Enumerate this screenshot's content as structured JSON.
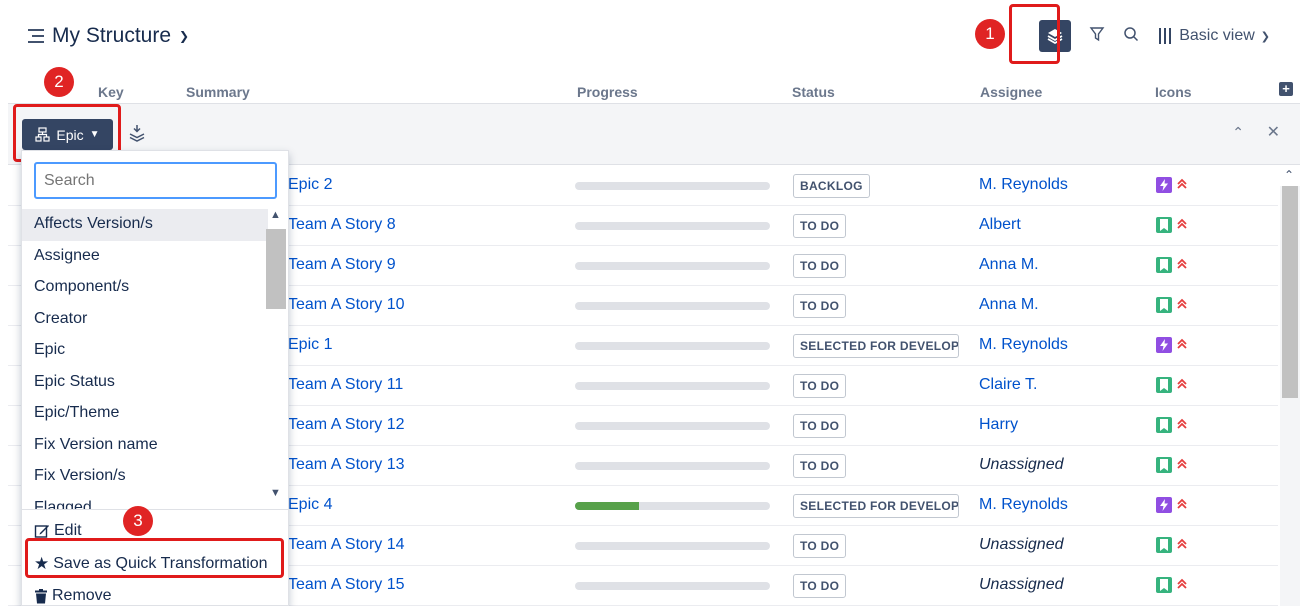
{
  "header": {
    "title": "My Structure",
    "view_label": "Basic view"
  },
  "columns": {
    "key": "Key",
    "summary": "Summary",
    "progress": "Progress",
    "status": "Status",
    "assignee": "Assignee",
    "icons": "Icons"
  },
  "transform": {
    "epic_label": "Epic"
  },
  "dropdown": {
    "search_placeholder": "Search",
    "items": [
      "Affects Version/s",
      "Assignee",
      "Component/s",
      "Creator",
      "Epic",
      "Epic Status",
      "Epic/Theme",
      "Fix Version name",
      "Fix Version/s",
      "Flagged"
    ],
    "edit_label": "Edit",
    "save_label": "Save as Quick Transformation",
    "remove_label": "Remove"
  },
  "callouts": [
    "1",
    "2",
    "3"
  ],
  "rows": [
    {
      "summary": "Epic 2",
      "progress": 0,
      "status": "BACKLOG",
      "assignee": "M. Reynolds",
      "type": "epic"
    },
    {
      "summary": "Team A Story 8",
      "progress": 0,
      "status": "TO DO",
      "assignee": "Albert",
      "type": "story"
    },
    {
      "summary": "Team A Story 9",
      "progress": 0,
      "status": "TO DO",
      "assignee": "Anna M.",
      "type": "story"
    },
    {
      "summary": "Team A Story 10",
      "progress": 0,
      "status": "TO DO",
      "assignee": "Anna M.",
      "type": "story"
    },
    {
      "summary": "Epic 1",
      "progress": 0,
      "status": "SELECTED FOR DEVELOPMENT",
      "assignee": "M. Reynolds",
      "type": "epic"
    },
    {
      "summary": "Team A Story 11",
      "progress": 0,
      "status": "TO DO",
      "assignee": "Claire T.",
      "type": "story"
    },
    {
      "summary": "Team A Story 12",
      "progress": 0,
      "status": "TO DO",
      "assignee": "Harry",
      "type": "story"
    },
    {
      "summary": "Team A Story 13",
      "progress": 0,
      "status": "TO DO",
      "assignee": "Unassigned",
      "type": "story"
    },
    {
      "summary": "Epic 4",
      "progress": 0.33,
      "status": "SELECTED FOR DEVELOPMENT",
      "assignee": "M. Reynolds",
      "type": "epic"
    },
    {
      "summary": "Team A Story 14",
      "progress": 0,
      "status": "TO DO",
      "assignee": "Unassigned",
      "type": "story"
    },
    {
      "summary": "Team A Story 15",
      "progress": 0,
      "status": "TO DO",
      "assignee": "Unassigned",
      "type": "story"
    }
  ]
}
